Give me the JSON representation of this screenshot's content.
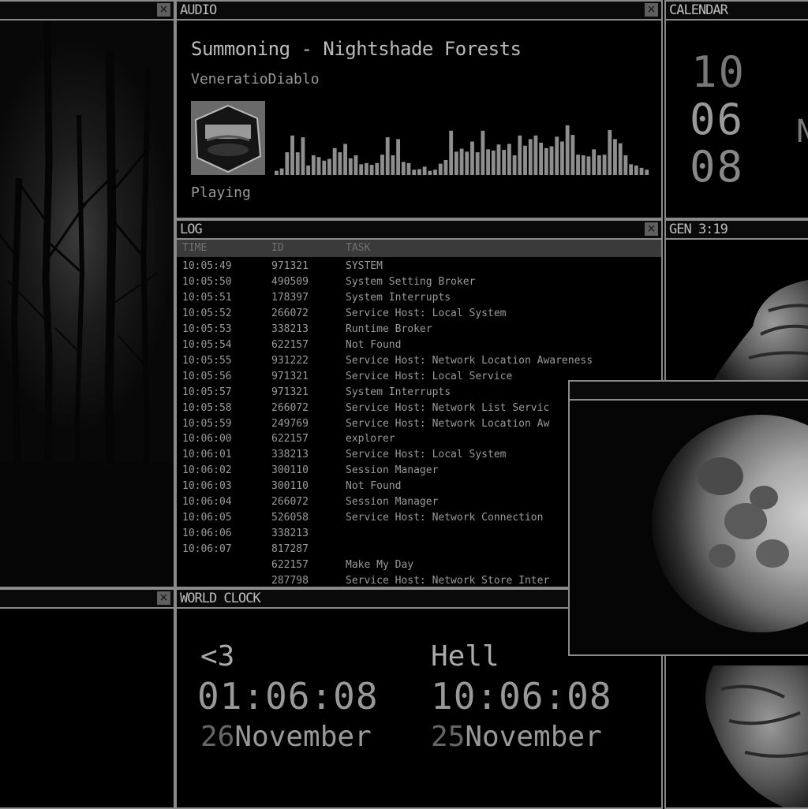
{
  "audio": {
    "title": "AUDIO",
    "track": "Summoning - Nightshade Forests",
    "artist": "VeneratioDiablo",
    "status": "Playing",
    "visualizer_levels": [
      0.07,
      0.11,
      0.38,
      0.66,
      0.38,
      0.63,
      0.16,
      0.33,
      0.3,
      0.24,
      0.27,
      0.45,
      0.38,
      0.52,
      0.28,
      0.33,
      0.18,
      0.2,
      0.17,
      0.2,
      0.34,
      0.63,
      0.33,
      0.6,
      0.22,
      0.2,
      0.09,
      0.1,
      0.14,
      0.07,
      0.09,
      0.19,
      0.25,
      0.74,
      0.39,
      0.44,
      0.39,
      0.56,
      0.38,
      0.74,
      0.43,
      0.41,
      0.51,
      0.42,
      0.52,
      0.33,
      0.66,
      0.49,
      0.6,
      0.66,
      0.54,
      0.45,
      0.48,
      0.64,
      0.56,
      0.83,
      0.67,
      0.34,
      0.33,
      0.31,
      0.43,
      0.33,
      0.34,
      0.75,
      0.6,
      0.53,
      0.33,
      0.18,
      0.16,
      0.12,
      0.09
    ]
  },
  "calendar": {
    "title": "CALENDAR",
    "hour": "10",
    "minute": "06",
    "second": "08",
    "side": "N"
  },
  "log": {
    "title": "LOG",
    "columns": [
      "TIME",
      "ID",
      "TASK"
    ],
    "rows": [
      [
        "10:05:49",
        "971321",
        "SYSTEM"
      ],
      [
        "10:05:50",
        "490509",
        "System Setting Broker"
      ],
      [
        "10:05:51",
        "178397",
        "System Interrupts"
      ],
      [
        "10:05:52",
        "266072",
        "Service Host: Local System"
      ],
      [
        "10:05:53",
        "338213",
        "Runtime Broker"
      ],
      [
        "10:05:54",
        "622157",
        "Not Found"
      ],
      [
        "10:05:55",
        "931222",
        "Service Host: Network Location Awareness"
      ],
      [
        "10:05:56",
        "971321",
        "Service Host: Local Service"
      ],
      [
        "10:05:57",
        "971321",
        "System Interrupts"
      ],
      [
        "10:05:58",
        "266072",
        "Service Host: Network List Servic"
      ],
      [
        "10:05:59",
        "249769",
        "Service Host: Network Location Aw"
      ],
      [
        "10:06:00",
        "622157",
        "explorer"
      ],
      [
        "10:06:01",
        "338213",
        "Service Host: Local System"
      ],
      [
        "10:06:02",
        "300110",
        "Session Manager"
      ],
      [
        "10:06:03",
        "300110",
        "Not Found"
      ],
      [
        "10:06:04",
        "266072",
        "Session Manager"
      ],
      [
        "10:06:05",
        "526058",
        "Service Host: Network Connection"
      ],
      [
        "10:06:06",
        "338213",
        ""
      ],
      [
        "10:06:07",
        "817287",
        ""
      ],
      [
        "",
        "622157",
        "Make My Day"
      ],
      [
        "",
        "287798",
        "Service Host: Network Store Inter"
      ]
    ]
  },
  "gen": {
    "title": "GEN 3:19"
  },
  "world_clock": {
    "title": "WORLD CLOCK",
    "zones": [
      {
        "name": "<3",
        "time": "01:06:08",
        "day": "26",
        "month": "November"
      },
      {
        "name": "Hell",
        "time": "10:06:08",
        "day": "25",
        "month": "November"
      }
    ]
  },
  "icons": {
    "close": "×"
  }
}
